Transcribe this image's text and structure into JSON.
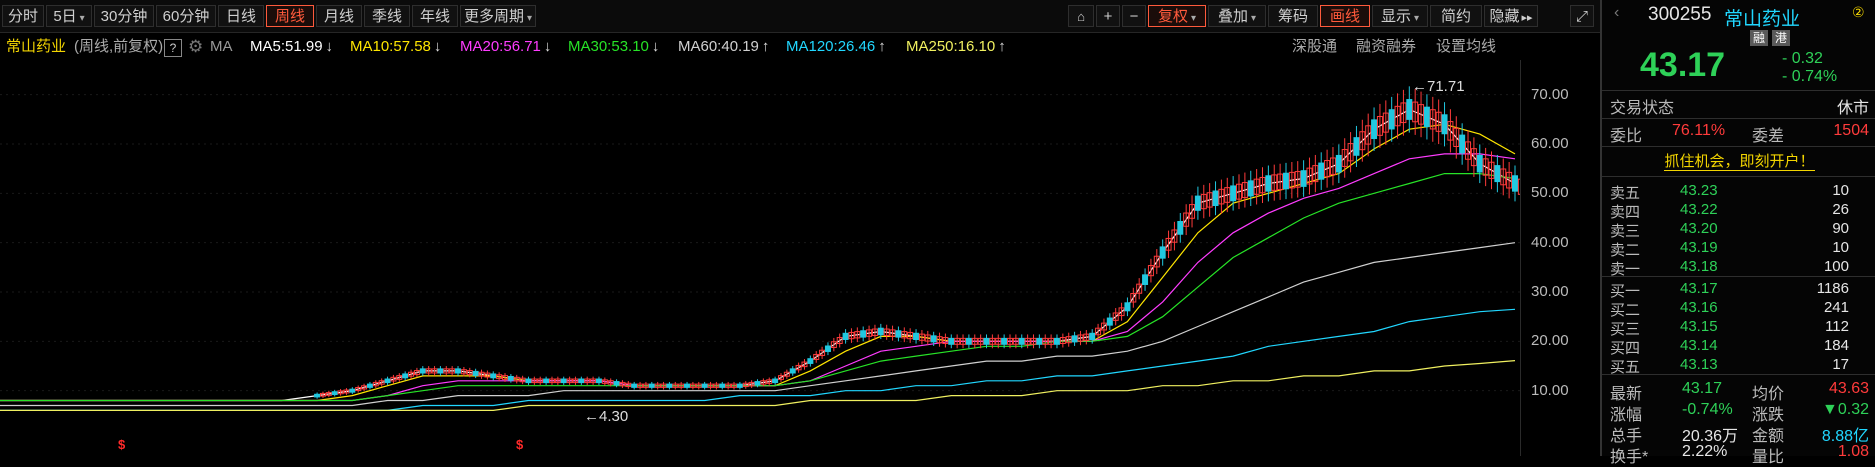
{
  "toolbar": {
    "left": [
      {
        "label": "分时",
        "caret": false,
        "active": false
      },
      {
        "label": "5日",
        "caret": true,
        "active": false
      },
      {
        "label": "30分钟",
        "caret": false,
        "active": false
      },
      {
        "label": "60分钟",
        "caret": false,
        "active": false
      },
      {
        "label": "日线",
        "caret": false,
        "active": false
      },
      {
        "label": "周线",
        "caret": false,
        "active": true
      },
      {
        "label": "月线",
        "caret": false,
        "active": false
      },
      {
        "label": "季线",
        "caret": false,
        "active": false
      },
      {
        "label": "年线",
        "caret": false,
        "active": false
      },
      {
        "label": "更多周期",
        "caret": true,
        "active": false
      }
    ],
    "right": [
      {
        "label": "复权",
        "caret": true,
        "active": true
      },
      {
        "label": "叠加",
        "caret": true,
        "active": false
      },
      {
        "label": "筹码",
        "caret": false,
        "active": false
      },
      {
        "label": "画线",
        "caret": false,
        "active": true
      },
      {
        "label": "显示",
        "caret": true,
        "active": false
      },
      {
        "label": "简约",
        "caret": false,
        "active": false
      },
      {
        "label": "隐藏",
        "caret": false,
        "active": false
      }
    ],
    "plus": "+",
    "minus": "−",
    "hide_arrows": "▸▸"
  },
  "ma_bar": {
    "stock_name": "常山药业",
    "mode": "(周线,前复权)",
    "help": "?",
    "ma_label": "MA",
    "items": [
      {
        "text": "MA5:51.99",
        "arrow": "↓",
        "color": "#ffffff"
      },
      {
        "text": "MA10:57.58",
        "arrow": "↓",
        "color": "#ffe600"
      },
      {
        "text": "MA20:56.71",
        "arrow": "↓",
        "color": "#ff3cff"
      },
      {
        "text": "MA30:53.10",
        "arrow": "↓",
        "color": "#27e327"
      },
      {
        "text": "MA60:40.19",
        "arrow": "↑",
        "color": "#d0d0d0"
      },
      {
        "text": "MA120:26.46",
        "arrow": "↑",
        "color": "#21d7ff"
      },
      {
        "text": "MA250:16.10",
        "arrow": "↑",
        "color": "#f0f060"
      }
    ],
    "links": [
      "深股通",
      "融资融券",
      "设置均线"
    ]
  },
  "chart_data": {
    "type": "line",
    "title": "",
    "ylim": [
      0,
      75
    ],
    "yticks": [
      "70.00",
      "60.00",
      "50.00",
      "40.00",
      "30.00",
      "20.00",
      "10.00"
    ],
    "ytick_values": [
      70,
      60,
      50,
      40,
      30,
      20,
      10
    ],
    "annotations": [
      {
        "text": "←71.71",
        "value": 71.71
      },
      {
        "text": "←4.30",
        "value": 4.3
      }
    ],
    "marker_symbol": "$",
    "series": [
      {
        "name": "MA5",
        "color": "#ffffff",
        "values": [
          8,
          8,
          8,
          8,
          8,
          8,
          8,
          8,
          8,
          9,
          10,
          12,
          14,
          14,
          13,
          12,
          12,
          12,
          11,
          11,
          11,
          11,
          12,
          16,
          21,
          22,
          21,
          20,
          20,
          20,
          20,
          21,
          27,
          38,
          48,
          50,
          52,
          53,
          56,
          63,
          67,
          64,
          56,
          52
        ]
      },
      {
        "name": "MA10",
        "color": "#ffe600",
        "values": [
          8,
          8,
          8,
          8,
          8,
          8,
          8,
          8,
          8,
          8,
          9,
          11,
          13,
          13,
          13,
          12,
          12,
          12,
          11,
          11,
          11,
          11,
          11,
          14,
          18,
          21,
          21,
          20,
          20,
          20,
          20,
          20,
          24,
          33,
          42,
          48,
          50,
          52,
          54,
          59,
          63,
          64,
          62,
          58
        ]
      },
      {
        "name": "MA20",
        "color": "#ff3cff",
        "values": [
          8,
          8,
          8,
          8,
          8,
          8,
          8,
          8,
          8,
          8,
          8,
          9,
          11,
          12,
          12,
          12,
          12,
          12,
          11,
          11,
          11,
          11,
          11,
          12,
          15,
          18,
          19,
          20,
          20,
          20,
          20,
          20,
          22,
          28,
          36,
          42,
          46,
          49,
          51,
          54,
          57,
          58,
          58,
          57
        ]
      },
      {
        "name": "MA30",
        "color": "#27e327",
        "values": [
          8,
          8,
          8,
          8,
          8,
          8,
          8,
          8,
          8,
          8,
          8,
          9,
          10,
          11,
          11,
          11,
          11,
          11,
          11,
          11,
          11,
          11,
          11,
          12,
          14,
          16,
          17,
          18,
          19,
          19,
          20,
          20,
          21,
          25,
          31,
          37,
          41,
          45,
          48,
          50,
          52,
          54,
          54,
          53
        ]
      },
      {
        "name": "MA60",
        "color": "#d0d0d0",
        "values": [
          7,
          7,
          7,
          7,
          7,
          7,
          7,
          7,
          7,
          7,
          7,
          8,
          8,
          9,
          9,
          9,
          10,
          10,
          10,
          10,
          10,
          10,
          10,
          11,
          12,
          13,
          14,
          15,
          16,
          16,
          17,
          17,
          18,
          20,
          23,
          26,
          29,
          32,
          34,
          36,
          37,
          38,
          39,
          40
        ]
      },
      {
        "name": "MA120",
        "color": "#21d7ff",
        "values": [
          6,
          6,
          6,
          6,
          6,
          6,
          6,
          6,
          6,
          6,
          6,
          6,
          7,
          7,
          7,
          8,
          8,
          8,
          8,
          8,
          8,
          9,
          9,
          9,
          10,
          10,
          11,
          11,
          12,
          12,
          13,
          13,
          14,
          15,
          16,
          17,
          19,
          20,
          21,
          22,
          24,
          25,
          26,
          26.5
        ]
      },
      {
        "name": "MA250",
        "color": "#f0f060",
        "values": [
          6,
          6,
          6,
          6,
          6,
          6,
          6,
          6,
          6,
          6,
          6,
          6,
          6,
          6,
          6,
          7,
          7,
          7,
          7,
          7,
          7,
          7,
          7,
          8,
          8,
          8,
          8,
          9,
          9,
          9,
          10,
          10,
          10,
          11,
          11,
          12,
          12,
          13,
          13,
          14,
          14,
          15,
          15.5,
          16.1
        ]
      }
    ]
  },
  "panel": {
    "code": "300255",
    "name": "常山药业",
    "badge": "②",
    "tags": [
      "融",
      "港"
    ],
    "price": "43.17",
    "change": "- 0.32",
    "change_pct": "- 0.74%",
    "status_label": "交易状态",
    "status_value": "休市",
    "weibi_label": "委比",
    "weibi_value": "76.11%",
    "weicha_label": "委差",
    "weicha_value": "1504",
    "promo": "抓住机会，即刻开户！",
    "asks": [
      {
        "label": "卖五",
        "price": "43.23",
        "vol": "10"
      },
      {
        "label": "卖四",
        "price": "43.22",
        "vol": "26"
      },
      {
        "label": "卖三",
        "price": "43.20",
        "vol": "90"
      },
      {
        "label": "卖二",
        "price": "43.19",
        "vol": "10"
      },
      {
        "label": "卖一",
        "price": "43.18",
        "vol": "100"
      }
    ],
    "bids": [
      {
        "label": "买一",
        "price": "43.17",
        "vol": "1186"
      },
      {
        "label": "买二",
        "price": "43.16",
        "vol": "241"
      },
      {
        "label": "买三",
        "price": "43.15",
        "vol": "112"
      },
      {
        "label": "买四",
        "price": "43.14",
        "vol": "184"
      },
      {
        "label": "买五",
        "price": "43.13",
        "vol": "17"
      }
    ],
    "stats": [
      {
        "l1": "最新",
        "v1": "43.17",
        "c1": "#2ed158",
        "l2": "均价",
        "v2": "43.63",
        "c2": "#ff3b3b"
      },
      {
        "l1": "涨幅",
        "v1": "-0.74%",
        "c1": "#2ed158",
        "l2": "涨跌",
        "v2": "▼0.32",
        "c2": "#2ed158"
      },
      {
        "l1": "总手",
        "v1": "20.36万",
        "c1": "#e6e6e6",
        "l2": "金额",
        "v2": "8.88亿",
        "c2": "#21d7ff"
      },
      {
        "l1": "换手*",
        "v1": "2.22%",
        "c1": "#e6e6e6",
        "l2": "量比",
        "v2": "1.08",
        "c2": "#ff3b3b"
      }
    ]
  }
}
